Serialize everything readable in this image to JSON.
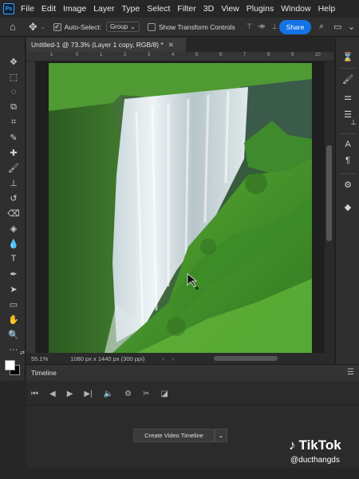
{
  "app": {
    "logo": "Ps"
  },
  "menu": [
    "File",
    "Edit",
    "Image",
    "Layer",
    "Type",
    "Select",
    "Filter",
    "3D",
    "View",
    "Plugins",
    "Window",
    "Help"
  ],
  "options": {
    "auto_select_label": "Auto-Select:",
    "auto_select_value": "Group",
    "transform_controls_label": "Show Transform Controls",
    "share_label": "Share"
  },
  "document": {
    "tab_title": "Untitled-1 @ 73.3% (Layer 1 copy, RGB/8) *",
    "zoom": "55.1%",
    "doc_info": "1080 px x 1440 px (300 ppi)"
  },
  "ruler_ticks": [
    "1",
    "0",
    "1",
    "2",
    "3",
    "4",
    "5",
    "6",
    "7",
    "8",
    "9",
    "10"
  ],
  "timeline": {
    "title": "Timeline",
    "create_label": "Create Video Timeline"
  },
  "overlay": {
    "brand": "TikTok",
    "handle": "@ducthangds"
  },
  "colors": {
    "accent": "#1473e6",
    "foreground": "#ffffff",
    "background": "#000000"
  }
}
